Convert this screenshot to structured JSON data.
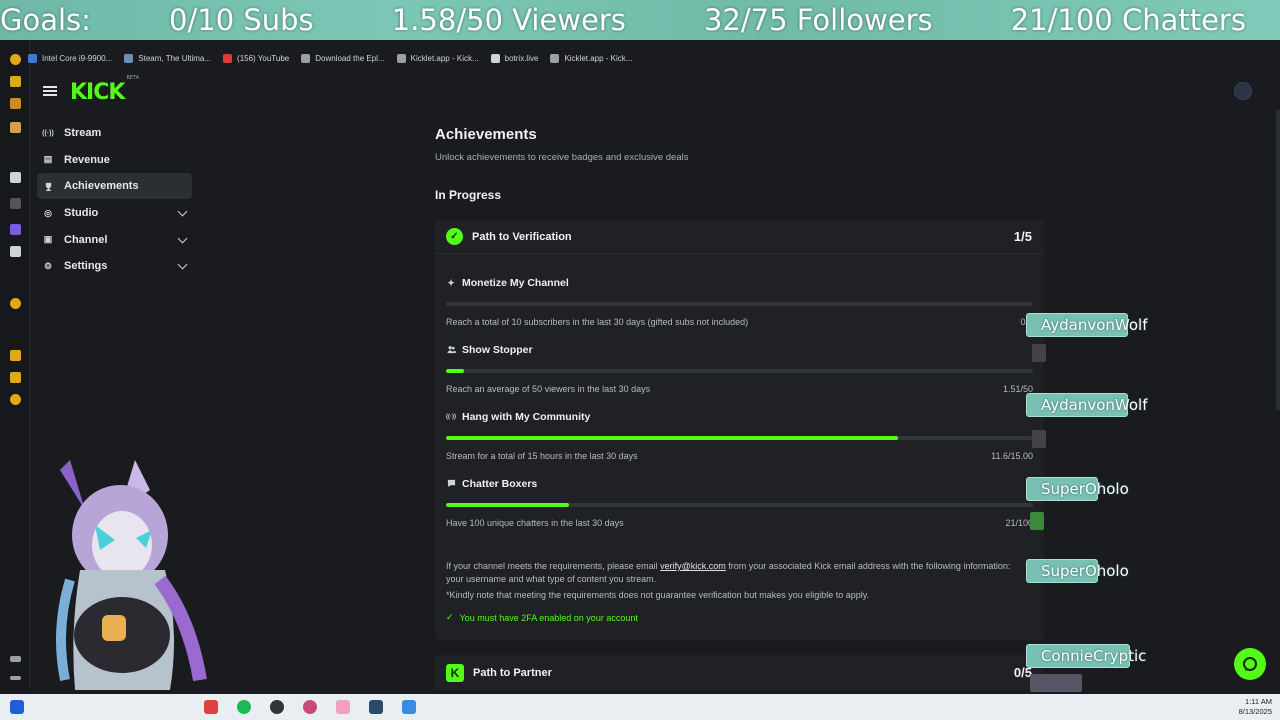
{
  "goals": {
    "label": "Goals:",
    "subs": "0/10 Subs",
    "viewers": "1.58/50 Viewers",
    "followers": "32/75 Followers",
    "chatters": "21/100 Chatters"
  },
  "bookmarks": [
    {
      "label": "Intel Core i9-9900...",
      "color": "#3a7bd5"
    },
    {
      "label": "Steam, The Ultima...",
      "color": "#6b8fb8"
    },
    {
      "label": "(156) YouTube",
      "color": "#e53935"
    },
    {
      "label": "Download the Epl...",
      "color": "#9aa0a6"
    },
    {
      "label": "Kicklet.app - Kick...",
      "color": "#9aa0a6"
    },
    {
      "label": "botrix.live",
      "color": "#cfd3d8"
    },
    {
      "label": "Kicklet.app - Kick...",
      "color": "#9aa0a6"
    }
  ],
  "header": {
    "logo": "KICK",
    "logo_tag": "BETA",
    "menu_icon": "hamburger-menu-icon"
  },
  "nav": {
    "items": [
      {
        "label": "Stream",
        "icon": "broadcast-icon",
        "glyph": "((·))"
      },
      {
        "label": "Revenue",
        "icon": "revenue-icon",
        "glyph": "▤"
      },
      {
        "label": "Achievements",
        "icon": "trophy-icon",
        "glyph": "🏆"
      },
      {
        "label": "Studio",
        "icon": "studio-icon",
        "glyph": "◎"
      },
      {
        "label": "Channel",
        "icon": "channel-icon",
        "glyph": "▣"
      },
      {
        "label": "Settings",
        "icon": "gear-icon",
        "glyph": "⚙"
      }
    ]
  },
  "main": {
    "title": "Achievements",
    "subtitle": "Unlock achievements to receive badges and exclusive deals",
    "section": "In Progress"
  },
  "card": {
    "title": "Path to Verification",
    "count": "1/5",
    "tasks": [
      {
        "title": "Monetize My Channel",
        "icon": "sparkle-icon",
        "glyph": "✦",
        "desc": "Reach a total of 10 subscribers in the last 30 days (gifted subs not included)",
        "value": "0/1",
        "progress": 0
      },
      {
        "title": "Show Stopper",
        "icon": "people-icon",
        "glyph": "👥",
        "desc": "Reach an average of 50 viewers in the last 30 days",
        "value": "1.51/50",
        "progress": 0.03
      },
      {
        "title": "Hang with My Community",
        "icon": "broadcast-icon",
        "glyph": "((·))",
        "desc": "Stream for a total of 15 hours in the last 30 days",
        "value": "11.6/15.00",
        "progress": 0.77
      },
      {
        "title": "Chatter Boxers",
        "icon": "chat-icon",
        "glyph": "💬",
        "desc": "Have 100 unique chatters in the last 30 days",
        "value": "21/100",
        "progress": 0.21
      }
    ],
    "note_before": "If your channel meets the requirements, please email ",
    "note_email": "verify@kick.com",
    "note_after": " from your associated Kick email address with the following information: your username and what type of content you stream.",
    "note2": "*Kindly note that meeting the requirements does not guarantee verification but makes you eligible to apply.",
    "requirement": "You must have 2FA enabled on your account"
  },
  "card2": {
    "title": "Path to Partner",
    "count": "0/5"
  },
  "chat": [
    {
      "name": "AydanvonWolf"
    },
    {
      "name": "AydanvonWolf"
    },
    {
      "name": "SuperOholo"
    },
    {
      "name": "SuperOholo"
    },
    {
      "name": "ConnieCryptic"
    }
  ],
  "taskbar": {
    "time": "1:11 AM",
    "date": "8/13/2025"
  },
  "colors": {
    "accent": "#53fc18",
    "background": "#191b1f",
    "card": "#1f2125",
    "overlay": "#78c0b3"
  }
}
